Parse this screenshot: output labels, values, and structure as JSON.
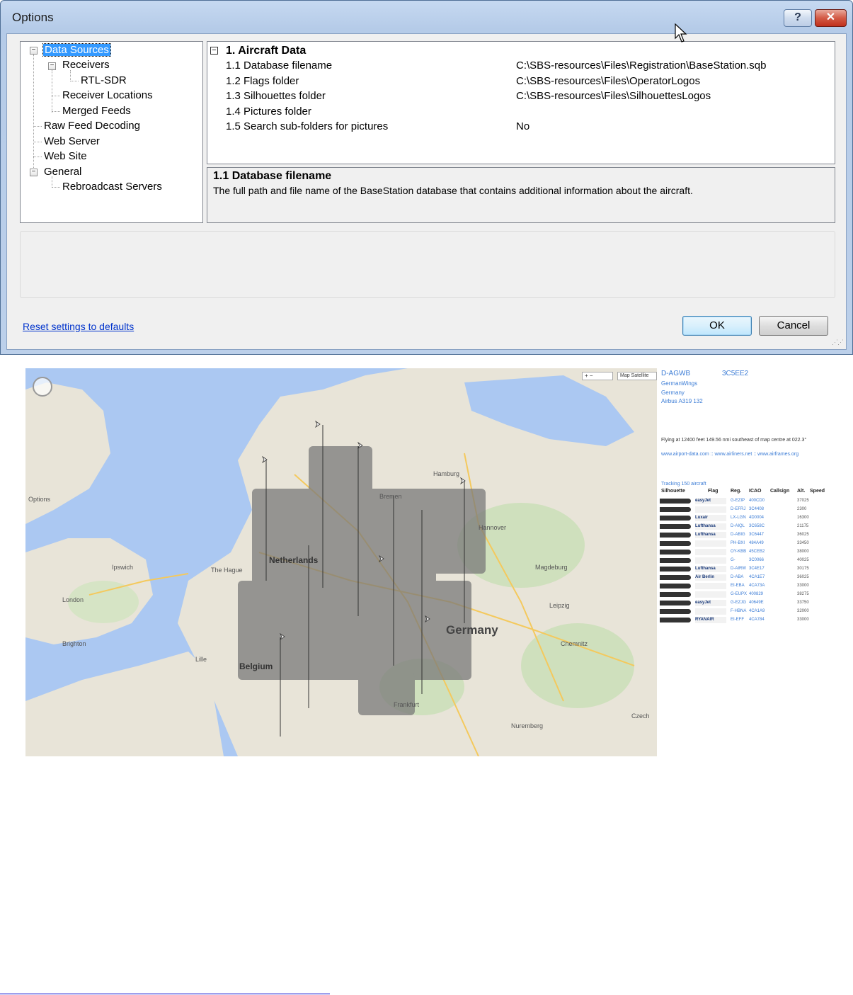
{
  "window": {
    "title": "Options",
    "help_label": "?",
    "close_label": "✕"
  },
  "tree": {
    "items": [
      {
        "label": "Data Sources",
        "selected": true,
        "expander": "−"
      },
      {
        "label": "Receivers",
        "expander": "−"
      },
      {
        "label": "RTL-SDR"
      },
      {
        "label": "Receiver Locations"
      },
      {
        "label": "Merged Feeds"
      },
      {
        "label": "Raw Feed Decoding"
      },
      {
        "label": "Web Server"
      },
      {
        "label": "Web Site"
      },
      {
        "label": "General",
        "expander": "−"
      },
      {
        "label": "Rebroadcast Servers"
      }
    ]
  },
  "properties": {
    "category": "1. Aircraft Data",
    "category_toggle": "−",
    "rows": [
      {
        "name": "1.1 Database filename",
        "value": "C:\\SBS-resources\\Files\\Registration\\BaseStation.sqb"
      },
      {
        "name": "1.2 Flags folder",
        "value": "C:\\SBS-resources\\Files\\OperatorLogos"
      },
      {
        "name": "1.3 Silhouettes folder",
        "value": "C:\\SBS-resources\\Files\\SilhouettesLogos"
      },
      {
        "name": "1.4 Pictures folder",
        "value": ""
      },
      {
        "name": "1.5 Search sub-folders for pictures",
        "value": "No"
      }
    ]
  },
  "description": {
    "title": "1.1 Database filename",
    "text": "The full path and file name of the BaseStation database that contains additional information about the aircraft."
  },
  "footer": {
    "reset_link": "Reset settings to defaults",
    "ok_label": "OK",
    "cancel_label": "Cancel"
  },
  "map": {
    "labels": [
      {
        "text": "Germany",
        "size": "big"
      },
      {
        "text": "Netherlands",
        "size": "mid"
      },
      {
        "text": "Belgium",
        "size": "mid"
      },
      {
        "text": "London",
        "size": "small"
      },
      {
        "text": "Hamburg",
        "size": "small"
      },
      {
        "text": "Bremen",
        "size": "small"
      },
      {
        "text": "The Hague",
        "size": "small"
      },
      {
        "text": "Hannover",
        "size": "small"
      },
      {
        "text": "Magdeburg",
        "size": "small"
      },
      {
        "text": "Brighton",
        "size": "small"
      },
      {
        "text": "Ipswich",
        "size": "small"
      },
      {
        "text": "Czech",
        "size": "small"
      },
      {
        "text": "Nuremberg",
        "size": "small"
      },
      {
        "text": "Frankfurt",
        "size": "small"
      },
      {
        "text": "Chemnitz",
        "size": "small"
      },
      {
        "text": "Leipzig",
        "size": "small"
      },
      {
        "text": "Lille",
        "size": "small"
      },
      {
        "text": "Options",
        "size": "small"
      }
    ],
    "zoom_control": "+ −",
    "maptype_control": "Map  Satellite",
    "sidebar": {
      "registration": "D-AGWB",
      "icao": "3C5EE2",
      "operator": "GermanWings",
      "country": "Germany",
      "model": "Airbus A319 132",
      "info_text": "Flying at 12400 feet 149.56 nmi southeast of map centre at 022.3°",
      "links": "www.airport-data.com :: www.airliners.net :: www.airframes.org",
      "tracking": "Tracking 150 aircraft",
      "columns": [
        "Silhouette",
        "Flag",
        "Reg.",
        "ICAO",
        "Callsign",
        "Alt.",
        "Speed"
      ],
      "rows": [
        {
          "flag": "easyJet",
          "reg": "G-EZIP",
          "icao": "400CD0",
          "alt": "37025"
        },
        {
          "flag": "",
          "reg": "D-EFRJ",
          "icao": "3C4408",
          "alt": "2300"
        },
        {
          "flag": "Luxair",
          "reg": "LX-LGN",
          "icao": "4D0004",
          "alt": "16300"
        },
        {
          "flag": "Lufthansa",
          "reg": "D-AIQL",
          "icao": "3C658C",
          "alt": "21175"
        },
        {
          "flag": "Lufthansa",
          "reg": "D-ABIG",
          "icao": "3C6447",
          "alt": "36025"
        },
        {
          "flag": "",
          "reg": "PH-BXI",
          "icao": "484A49",
          "alt": "33450"
        },
        {
          "flag": "",
          "reg": "OY-KBB",
          "icao": "45CEB2",
          "alt": "38000"
        },
        {
          "flag": "",
          "reg": "G-",
          "icao": "3C0066",
          "alt": "40025"
        },
        {
          "flag": "Lufthansa",
          "reg": "D-AIRW",
          "icao": "3C4E17",
          "alt": "30175"
        },
        {
          "flag": "Air Berlin",
          "reg": "D-ABA",
          "icao": "4CA1E7",
          "alt": "36025"
        },
        {
          "flag": "",
          "reg": "EI-EBA",
          "icao": "4CA73A",
          "alt": "33000"
        },
        {
          "flag": "",
          "reg": "G-EUPX",
          "icao": "400829",
          "alt": "38275"
        },
        {
          "flag": "easyJet",
          "reg": "G-EZJG",
          "icao": "40649E",
          "alt": "33750"
        },
        {
          "flag": "",
          "reg": "F-HBNA",
          "icao": "4CA1A9",
          "alt": "32000"
        },
        {
          "flag": "RYANAIR",
          "reg": "EI-EFF",
          "icao": "4CA784",
          "alt": "33000"
        }
      ]
    }
  }
}
